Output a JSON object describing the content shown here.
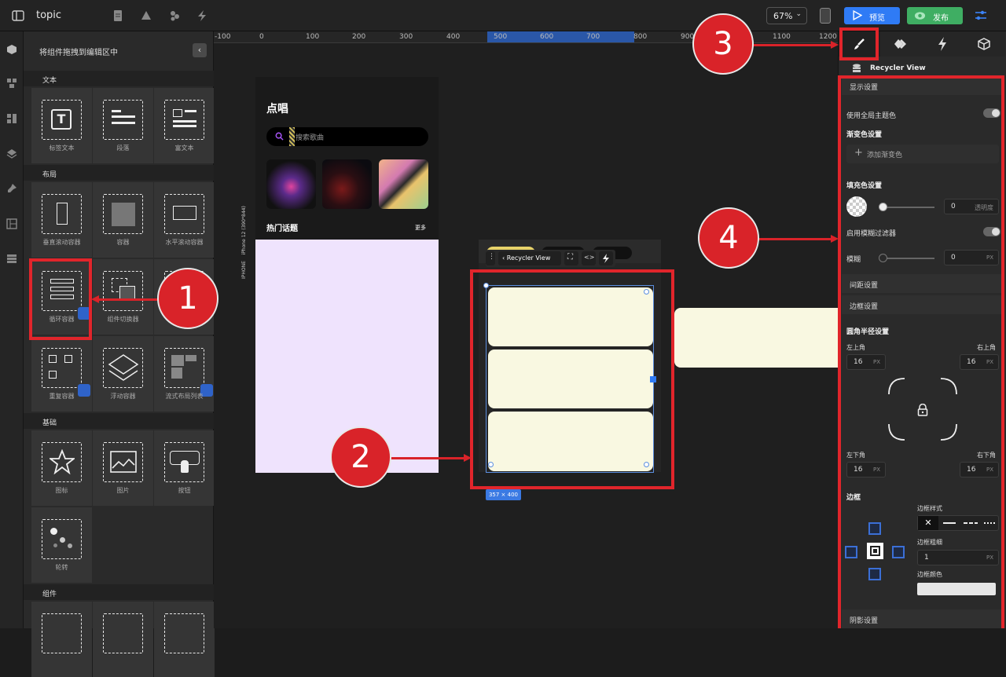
{
  "topbar": {
    "title": "topic",
    "zoom": "67%",
    "preview": "预览",
    "publish": "发布"
  },
  "panel": {
    "header": "将组件拖拽到编辑区中",
    "sections": [
      "文本",
      "布局",
      "基础",
      "组件"
    ],
    "text_tiles": [
      "标签文本",
      "段落",
      "富文本"
    ],
    "layout_tiles": [
      "垂直滚动容器",
      "容器",
      "水平滚动容器",
      "循环容器",
      "组件切换器",
      "重复容器",
      "浮动容器",
      "流式布局列表"
    ],
    "basic_tiles": [
      "图标",
      "图片",
      "按钮",
      "轮转"
    ]
  },
  "ruler": {
    "ticks": [
      "-100",
      "0",
      "100",
      "200",
      "300",
      "400",
      "500",
      "600",
      "700",
      "800",
      "900",
      "1000",
      "1100",
      "1200"
    ]
  },
  "canvas": {
    "phone_label": "IPHONE",
    "phone_model": "iPhone 12 (390*844)",
    "screen_title": "点唱",
    "search_placeholder": "搜索歌曲",
    "hot_title": "热门话题",
    "hot_more": "更多",
    "toolbar_label": "Recycler View",
    "size_badge": "357 × 400"
  },
  "inspector": {
    "component": "Recycler View",
    "display_settings": "显示设置",
    "use_global_theme": "使用全局主题色",
    "gradient_settings": "渐变色设置",
    "add_gradient": "添加渐变色",
    "fill_settings": "填充色设置",
    "opacity_value": "0",
    "opacity_label": "透明度",
    "blur_filter": "启用模糊过滤器",
    "blur": "模糊",
    "blur_value": "0",
    "unit_px": "PX",
    "spacing": "间距设置",
    "border_settings": "边框设置",
    "radius_settings": "圆角半径设置",
    "top_left": "左上角",
    "top_right": "右上角",
    "bottom_left": "左下角",
    "bottom_right": "右下角",
    "tl_value": "16",
    "tr_value": "16",
    "bl_value": "16",
    "br_value": "16",
    "border": "边框",
    "border_style": "边框样式",
    "border_width": "边框粗细",
    "border_width_value": "1",
    "border_color": "边框颜色",
    "shadow": "阴影设置"
  },
  "annotations": [
    "1",
    "2",
    "3",
    "4"
  ],
  "colors": {
    "accent_blue": "#2f7bf5",
    "publish_green": "#3fae63",
    "annotation_red": "#e1252b",
    "card": "#f9f8e1",
    "lavender": "#efe3fd"
  }
}
